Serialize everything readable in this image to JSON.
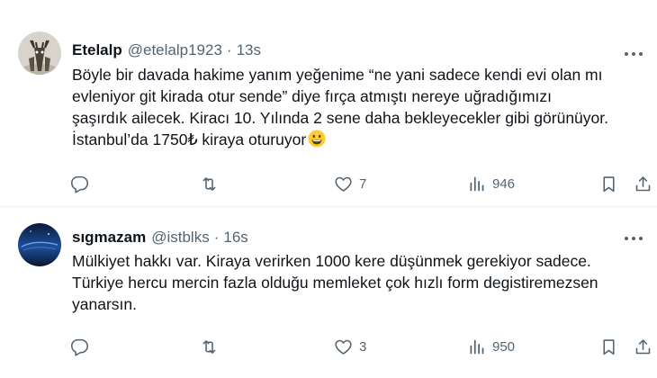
{
  "colors": {
    "text": "#0f1419",
    "secondary": "#536471",
    "divider": "#eff3f4",
    "emoji": "#ffcc2e"
  },
  "tweets": [
    {
      "author_name": "Etelalp",
      "handle": "@etelalp1923",
      "separator": "·",
      "time": "13s",
      "avatar_icon": "deer-avatar-icon",
      "text_lines": [
        "Böyle bir davada hakime yanım yeğenime “ne yani sadece kendi evi olan mı",
        "evleniyor git kirada otur sende” diye fırça atmıştı nereye uğradığımızı",
        "şaşırdık ailecek. Kiracı 10. Yılında 2 sene daha bekleyecekler gibi görünüyor.",
        "İstanbul’da 1750₺ kiraya oturuyor"
      ],
      "emoji": "grinning-face-emoji",
      "replies": "",
      "retweets": "",
      "likes": "7",
      "views": "946"
    },
    {
      "author_name": "sıgmazam",
      "handle": "@istblks",
      "separator": "·",
      "time": "16s",
      "avatar_icon": "blue-sky-avatar-icon",
      "text_lines": [
        "Mülkiyet hakkı var. Kiraya verirken 1000 kere düşünmek gerekiyor sadece.",
        "Türkiye hercu mercin fazla olduğu memleket çok hızlı form degistiremezsen",
        "yanarsın."
      ],
      "replies": "",
      "retweets": "",
      "likes": "3",
      "views": "950"
    }
  ]
}
